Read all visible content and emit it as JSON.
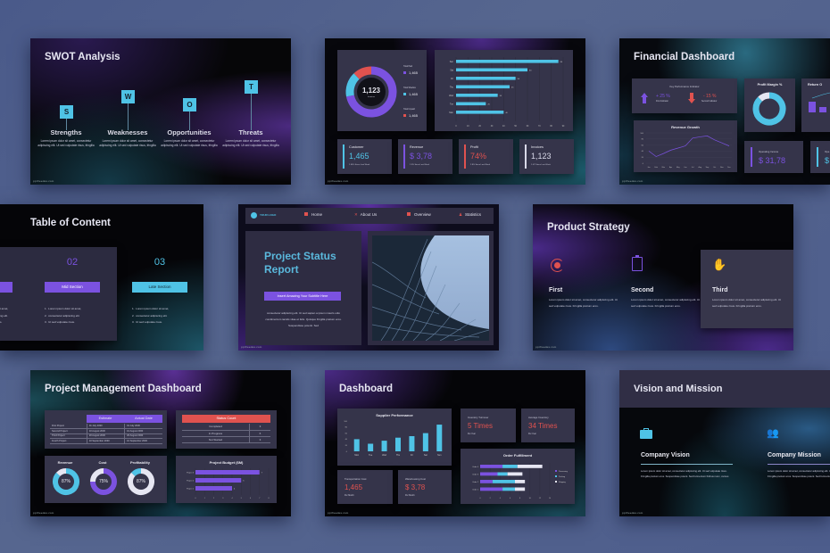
{
  "watermark": "pptfreedes.com",
  "swot": {
    "title": "SWOT Analysis",
    "items": [
      {
        "letter": "S",
        "heading": "Strengths",
        "body": "Lorem ipsum dolor sit amet, consectetur adipiscing elit. Ut sed vulputate risus, fringilla"
      },
      {
        "letter": "W",
        "heading": "Weaknesses",
        "body": "Lorem ipsum dolor sit amet, consectetur adipiscing elit. Ut sed vulputate risus, fringilla"
      },
      {
        "letter": "O",
        "heading": "Opportunities",
        "body": "Lorem ipsum dolor sit amet, consectetur adipiscing elit. Ut sed vulputate risus, fringilla"
      },
      {
        "letter": "T",
        "heading": "Threats",
        "body": "Lorem ipsum dolor sit amet, consectetur adipiscing elit. Ut sed vulputate risus, fringilla"
      }
    ]
  },
  "sales": {
    "donut_center": "1,123",
    "donut_center_label": "Invoices",
    "legend": [
      {
        "label": "Total Paid",
        "value": "1,465",
        "color": "#7b52e0"
      },
      {
        "label": "Total Shadow",
        "value": "1,465",
        "color": "#4fc3e6"
      },
      {
        "label": "Total Unpaid",
        "value": "1,465",
        "color": "#e0524f"
      }
    ],
    "donut_shares": [
      0.72,
      0.16,
      0.12
    ],
    "bars": {
      "categories": [
        "Sun",
        "Sat",
        "Fri",
        "Thu",
        "Wed",
        "Tue",
        "Mon"
      ],
      "values": [
        86,
        60,
        50,
        45,
        35,
        25,
        40
      ],
      "ticks": [
        "0",
        "10",
        "20",
        "30",
        "40",
        "50",
        "60",
        "70",
        "80",
        "90"
      ],
      "max": 90
    },
    "kpis": [
      {
        "label": "Customer",
        "value": "1,465",
        "sub": "1.54%  Since Last Week",
        "color": "#4fc3e6"
      },
      {
        "label": "Revenue",
        "value": "$ 3,78",
        "sub": "1.3%  Since Last Week",
        "color": "#7b52e0"
      },
      {
        "label": "Profit",
        "value": "74%",
        "sub": "2.8%  Since Last Week",
        "color": "#e0524f"
      },
      {
        "label": "Invoices",
        "value": "1,123",
        "sub": "1.4/7  Since Last Week",
        "color": "#d8d8e8"
      }
    ]
  },
  "financial": {
    "title": "Financial Dashboard",
    "kpi_title": "Key Performance Indicator",
    "kpi_up": {
      "value": "+ 25 %",
      "label": "First Indicator"
    },
    "kpi_down": {
      "value": "- 15 %",
      "label": "Second Indicator"
    },
    "profit_margin_title": "Profit Margin %",
    "profit_margin": 0.88,
    "return_title": "Return O",
    "revenue_growth": {
      "title": "Revenue Growth",
      "months": [
        "Jan",
        "Feb",
        "Mar",
        "Apr",
        "May",
        "Jun",
        "Jul",
        "Aug",
        "Sep",
        "Oct",
        "Nov",
        "Dec"
      ],
      "values": [
        40,
        22,
        32,
        43,
        50,
        57,
        83,
        87,
        90,
        77,
        67,
        57
      ],
      "yticks": [
        "100",
        "80",
        "60",
        "40",
        "20",
        "0"
      ]
    },
    "operating_income_label": "Operating Income",
    "operating_income_value": "$ 31,78",
    "ope_cut_label": "Ope",
    "ope_cut_value": "$ "
  },
  "toc": {
    "title": "Table of Content",
    "sections": [
      {
        "num": "02",
        "label": "Mid Section",
        "color": "#7b52e0",
        "items": [
          "Lorem ipsum dolor sit amet,",
          "consectetur adipiscing elit.",
          "Ut sed vulputate risus."
        ]
      },
      {
        "num": "03",
        "label": "Late Section",
        "color": "#4fc3e6",
        "items": [
          "Lorem ipsum dolor sit amet,",
          "consectetur adipiscing elit.",
          "Ut sed vulputate risus."
        ]
      }
    ],
    "partial_items": [
      "t amet,",
      "ng elit.",
      "s."
    ]
  },
  "project_status": {
    "logo": "YOUR LOGO",
    "nav": [
      "Home",
      "About Us",
      "Overview",
      "Statistics"
    ],
    "title_line1": "Project Status",
    "title_line2": "Report",
    "subtitle_button": "Insert Amazing Your Subtitle Here",
    "body": "consectetur adipiscing elit. Ut sed sapien a ipsum mauris odio condimentum iaculis vitae et felis. Quisque fringilla pretium eros. Suspendisse potenti. Sed"
  },
  "product_strategy": {
    "title": "Product Strategy",
    "items": [
      {
        "heading": "First",
        "body": "Lorem ipsum dolor sit amet, consectetur adipiscing elit. Ut sed vulputate risus. Fringilla pretium eros."
      },
      {
        "heading": "Second",
        "body": "Lorem ipsum dolor sit amet, consectetur adipiscing elit. Ut sed vulputate risus. Fringilla pretium eros."
      },
      {
        "heading": "Third",
        "body": "Lorem ipsum dolor sit amet, consectetur adipiscing elit. Ut sed vulputate risus. Fringilla pretium eros."
      }
    ]
  },
  "pm_dashboard": {
    "title": "Project Management Dashboard",
    "table_headers": [
      "Estimate",
      "Actual Date"
    ],
    "table_rows": [
      [
        "First Project",
        "01 July 2030",
        "01 July 2030"
      ],
      [
        "Second Project",
        "10 August 2030",
        "10 August 2030"
      ],
      [
        "Third Project",
        "20 August 2030",
        "20 August 2030"
      ],
      [
        "Fourth Project",
        "10 September 2030",
        "10 September 2030"
      ]
    ],
    "status_title": "Status Count",
    "status_rows": [
      [
        "Completed",
        "3"
      ],
      [
        "In Progress",
        "6"
      ],
      [
        "Not Started",
        "3"
      ]
    ],
    "donuts": [
      {
        "label": "Revenue",
        "pct": 87,
        "text": "87%",
        "color": "#4fc3e6",
        "track": "#e6e6f2"
      },
      {
        "label": "Cost",
        "pct": 75,
        "text": "75%",
        "color": "#7b52e0",
        "track": "#e6e6f2"
      },
      {
        "label": "Profitability",
        "pct": 87,
        "text": "87%",
        "color": "#e6e6f2",
        "track": "#4fc3e6"
      }
    ],
    "budget": {
      "title": "Project Budget ($M)",
      "categories": [
        "Project 3",
        "Project 2",
        "Project 1"
      ],
      "values": [
        7,
        5,
        4
      ],
      "ticks": [
        "0",
        "1",
        "2",
        "3",
        "4",
        "5",
        "6",
        "7",
        "8"
      ],
      "max": 8
    }
  },
  "dashboard": {
    "title": "Dashboard",
    "supplier": {
      "title": "Supplier Performance",
      "categories": [
        "Mon",
        "Tue",
        "Wed",
        "Thu",
        "Fri",
        "Sat",
        "Sun"
      ],
      "values": [
        40,
        25,
        35,
        45,
        50,
        60,
        88
      ],
      "yticks": [
        "100",
        "80",
        "60",
        "40",
        "20",
        "0"
      ],
      "max": 100
    },
    "inventory_turnover": {
      "label": "Inventory Turnover",
      "value": "5 Times",
      "sub": "Per Year"
    },
    "average_inventory": {
      "label": "Average Inventory",
      "value": "34 Times",
      "sub": "Per Year"
    },
    "transportation": {
      "label": "Transportation Cost",
      "value": "1,465",
      "sub": "Per Month"
    },
    "warehousing": {
      "label": "Warehousing Cost",
      "value": "$ 3,78",
      "sub": "Per Month"
    },
    "order": {
      "title": "Order Fulfillment",
      "categories": [
        "Order 4",
        "Order 3",
        "Order 2",
        "Order 1"
      ],
      "series": [
        {
          "name": "Processing",
          "values": [
            4.5,
            3.5,
            2.5,
            4.5
          ],
          "color": "#7b52e0"
        },
        {
          "name": "Packing",
          "values": [
            3,
            2,
            4.5,
            2.5
          ],
          "color": "#4fc3e6"
        },
        {
          "name": "Shipping",
          "values": [
            5,
            3,
            2,
            2
          ],
          "color": "#e6e6f2"
        }
      ],
      "ticks": [
        "0",
        "2",
        "4",
        "6",
        "8",
        "10",
        "12",
        "14"
      ],
      "max": 14
    }
  },
  "vision": {
    "title": "Vision and Mission",
    "items": [
      {
        "heading": "Company Vision",
        "body": "Lorem ipsum dolor sit amet, consectetur adipiscing elit. Ut sed vulputate risus. Fringilla pretium eros. Suspendisse potent. Sed fermentum finibus nunc, cursus"
      },
      {
        "heading": "Company Mission",
        "body": "Lorem ipsum dolor sit amet, consectetur adipiscing elit. Ut sed vulputate risus. Fringilla pretium eros. Suspendisse potent. Sed fermentum finibus nunc, cursus"
      }
    ]
  }
}
